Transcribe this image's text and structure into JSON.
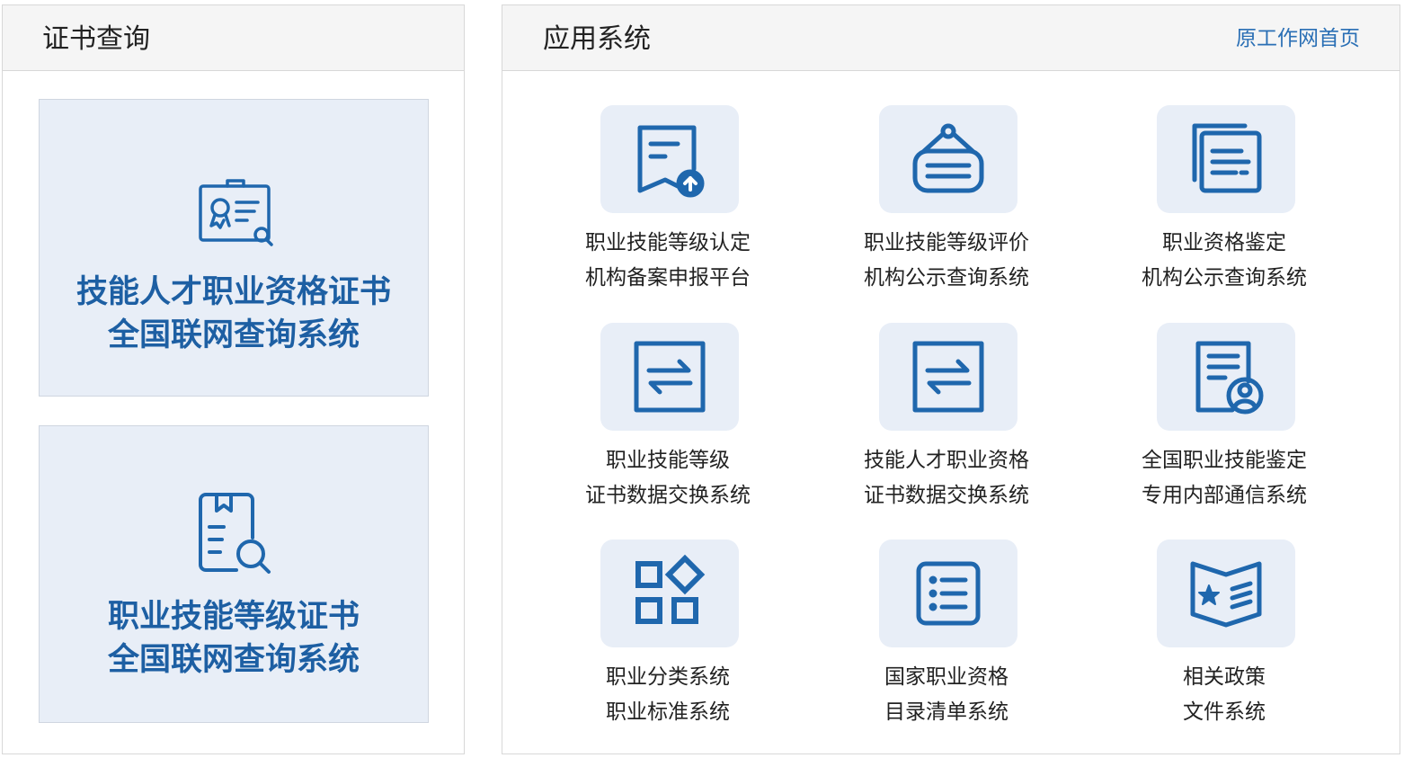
{
  "cert_panel": {
    "title": "证书查询",
    "cards": [
      {
        "line1": "技能人才职业资格证书",
        "line2": "全国联网查询系统",
        "icon": "certificate-search-icon"
      },
      {
        "line1": "职业技能等级证书",
        "line2": "全国联网查询系统",
        "icon": "document-search-icon"
      }
    ]
  },
  "app_panel": {
    "title": "应用系统",
    "link_label": "原工作网首页",
    "apps": [
      {
        "line1": "职业技能等级认定",
        "line2": "机构备案申报平台",
        "icon": "document-upload-icon"
      },
      {
        "line1": "职业技能等级评价",
        "line2": "机构公示查询系统",
        "icon": "hanging-sign-icon"
      },
      {
        "line1": "职业资格鉴定",
        "line2": "机构公示查询系统",
        "icon": "stacked-cards-icon"
      },
      {
        "line1": "职业技能等级",
        "line2": "证书数据交换系统",
        "icon": "exchange-arrows-icon"
      },
      {
        "line1": "技能人才职业资格",
        "line2": "证书数据交换系统",
        "icon": "exchange-arrows-icon"
      },
      {
        "line1": "全国职业技能鉴定",
        "line2": "专用内部通信系统",
        "icon": "document-user-icon"
      },
      {
        "line1": "职业分类系统",
        "line2": "职业标准系统",
        "icon": "category-grid-icon"
      },
      {
        "line1": "国家职业资格",
        "line2": "目录清单系统",
        "icon": "list-icon"
      },
      {
        "line1": "相关政策",
        "line2": "文件系统",
        "icon": "policy-book-icon"
      }
    ]
  },
  "colors": {
    "accent": "#1d5fa3",
    "icon_blue": "#1f67ad",
    "card_bg": "#e8eef7",
    "link": "#2a6fb5"
  }
}
